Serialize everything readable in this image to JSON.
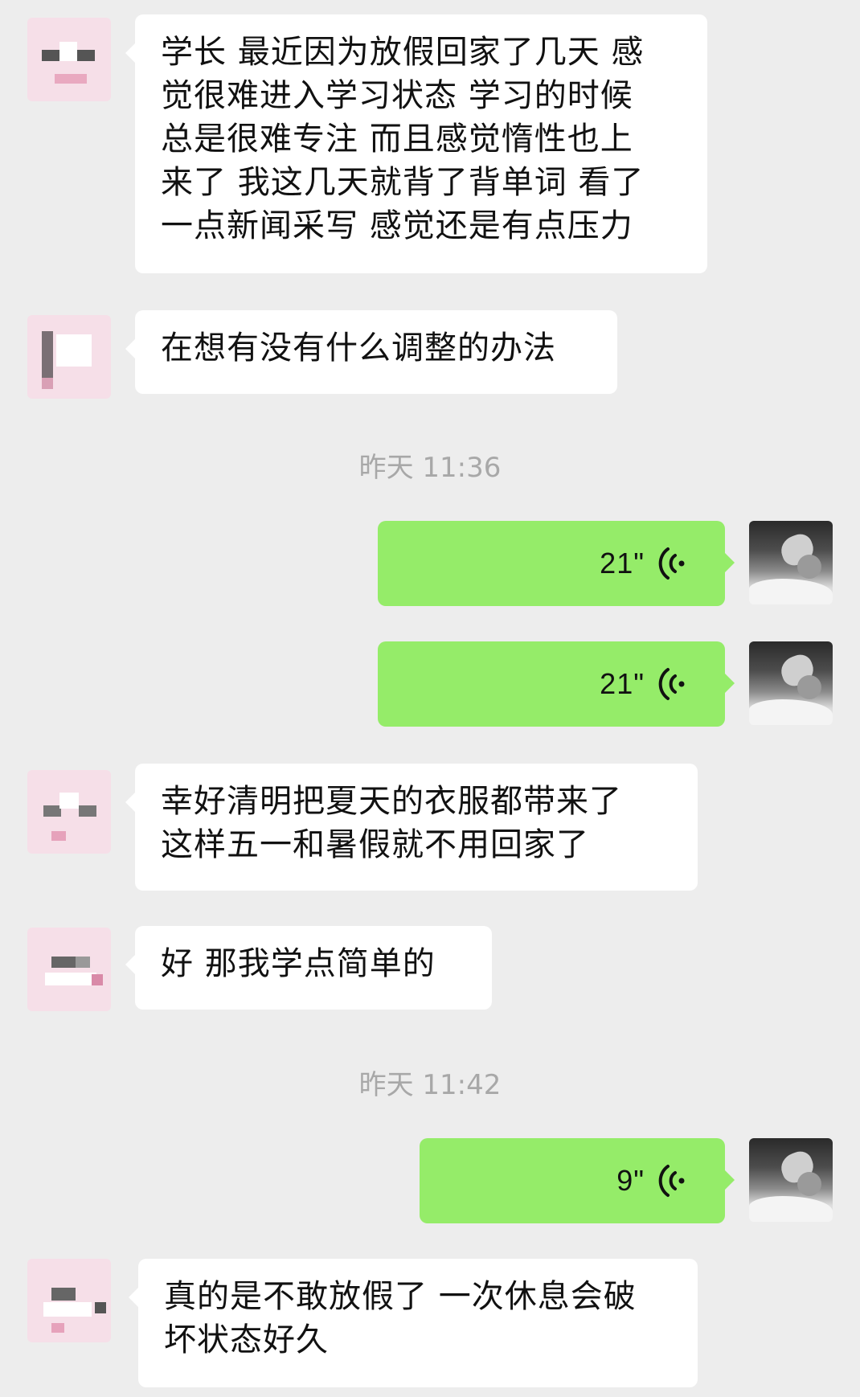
{
  "messages": [
    {
      "type": "received",
      "lines": [
        "学长 最近因为放假回家了几天 感",
        "觉很难进入学习状态 学习的时候",
        "总是很难专注 而且感觉惰性也上",
        "来了 我这几天就背了背单词 看了",
        "一点新闻采写 感觉还是有点压力"
      ]
    },
    {
      "type": "received",
      "lines": [
        "在想有没有什么调整的办法"
      ]
    },
    {
      "type": "timestamp",
      "text": "昨天 11:36"
    },
    {
      "type": "sent-voice",
      "duration": "21\""
    },
    {
      "type": "sent-voice",
      "duration": "21\""
    },
    {
      "type": "received",
      "lines": [
        "幸好清明把夏天的衣服都带来了",
        "这样五一和暑假就不用回家了"
      ]
    },
    {
      "type": "received",
      "lines": [
        "好 那我学点简单的"
      ]
    },
    {
      "type": "timestamp",
      "text": "昨天 11:42"
    },
    {
      "type": "sent-voice",
      "duration": "9\""
    },
    {
      "type": "received",
      "lines": [
        "真的是不敢放假了 一次休息会破",
        "坏状态好久"
      ]
    }
  ],
  "colors": {
    "background": "#ededed",
    "received_bubble": "#ffffff",
    "sent_bubble": "#95ec69",
    "timestamp_text": "#a8a8a8",
    "pixelated_avatar": "#f6dfe8"
  },
  "icons": {
    "voice": "voice-wave-icon",
    "contact_avatar": "pixelated-avatar",
    "self_avatar": "photo-avatar"
  }
}
